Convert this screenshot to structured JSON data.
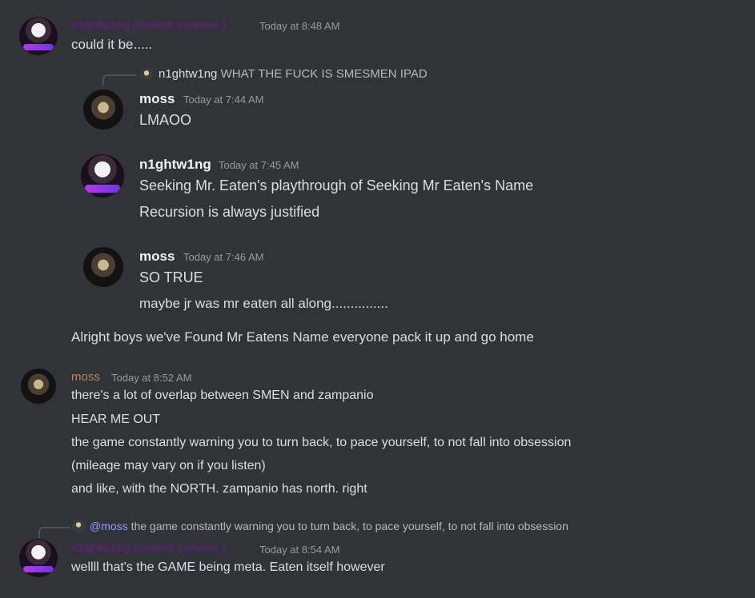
{
  "messages": {
    "m1": {
      "author": "n1ghtw1ng (realest survivor )",
      "timestamp": "Today at 8:48 AM",
      "text": "could it be....."
    },
    "quote": {
      "reply": {
        "author": "n1ghtw1ng",
        "text": "WHAT THE FUCK IS SMESMEN IPAD"
      },
      "q1": {
        "author": "moss",
        "timestamp": "Today at 7:44 AM",
        "lines": [
          "LMAOO"
        ]
      },
      "q2": {
        "author": "n1ghtw1ng",
        "timestamp": "Today at 7:45 AM",
        "lines": [
          "Seeking Mr. Eaten's playthrough of Seeking Mr Eaten's Name",
          "Recursion is always justified"
        ]
      },
      "q3": {
        "author": "moss",
        "timestamp": "Today at 7:46 AM",
        "lines": [
          "SO TRUE",
          "maybe jr was mr eaten all along..............."
        ]
      }
    },
    "m2": {
      "text": "Alright boys we've Found Mr Eatens Name everyone pack it up and go home"
    },
    "m3": {
      "author": "moss",
      "timestamp": "Today at 8:52 AM",
      "lines": [
        "there's a lot of overlap between SMEN and zampanio",
        "HEAR ME OUT",
        "the game constantly warning you to turn back, to pace yourself, to not fall into obsession",
        "(mileage may vary on if you listen)",
        "and like, with the NORTH. zampanio has north. right"
      ]
    },
    "m4": {
      "reply": {
        "mention": "@moss",
        "text": "the game constantly warning you to turn back, to pace yourself, to not fall into obsession"
      },
      "author": "n1ghtw1ng (realest survivor )",
      "timestamp": "Today at 8:54 AM",
      "text": "wellll that's the GAME being meta. Eaten itself however"
    }
  }
}
